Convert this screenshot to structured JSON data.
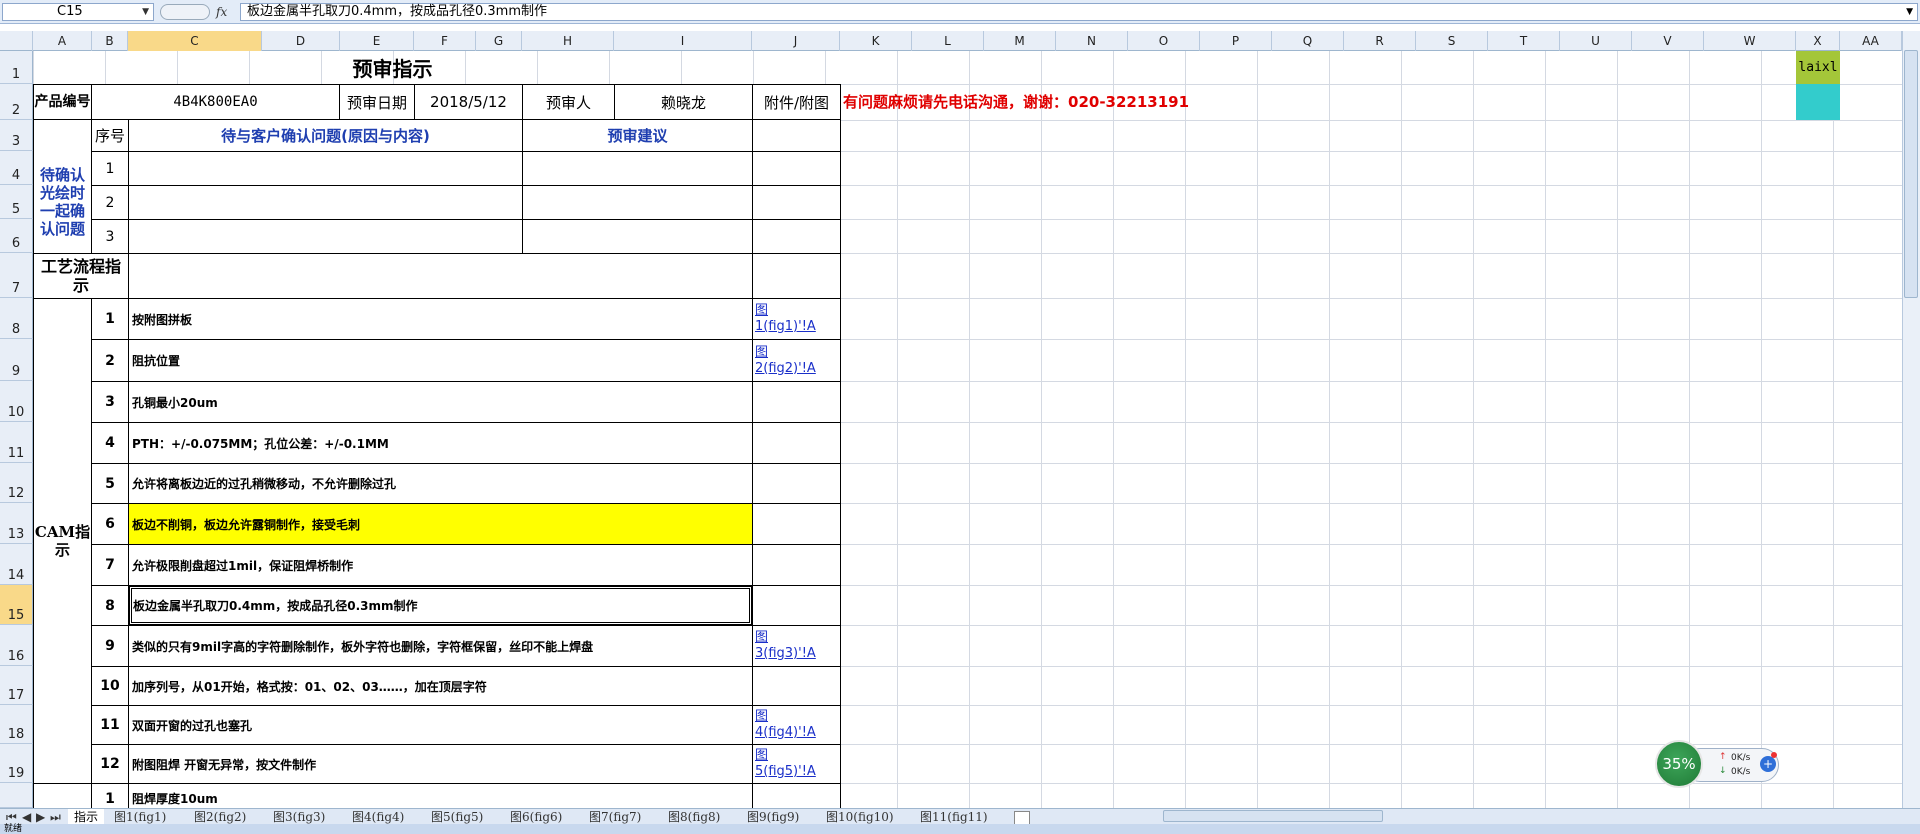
{
  "formula_bar": {
    "name_box": "C15",
    "fx_label": "fx",
    "formula": "板边金属半孔取刀0.4mm，按成品孔径0.3mm制作"
  },
  "columns": [
    "A",
    "B",
    "C",
    "D",
    "E",
    "F",
    "G",
    "H",
    "I",
    "J",
    "K",
    "L",
    "M",
    "N",
    "O",
    "P",
    "Q",
    "R",
    "S",
    "T",
    "U",
    "V",
    "W",
    "X",
    "AA"
  ],
  "rows": [
    "1",
    "2",
    "3",
    "4",
    "5",
    "6",
    "7",
    "8",
    "9",
    "10",
    "11",
    "12",
    "13",
    "14",
    "15",
    "16",
    "17",
    "18",
    "19"
  ],
  "sheet": {
    "title": "预审指示",
    "product_no_label": "产品编号",
    "product_no": "4B4K800EA0",
    "review_date_label": "预审日期",
    "review_date": "2018/5/12",
    "reviewer_label": "预审人",
    "reviewer": "赖晓龙",
    "attachment_label": "附件/附图",
    "contact_note": "有问题麻烦请先电话沟通，谢谢：020-32213191",
    "x1_value": "laixl",
    "seq_label": "序号",
    "question_header": "待与客户确认问题(原因与内容)",
    "suggestion_header": "预审建议",
    "pending_label": "待确认光绘时一起确认问题",
    "pending_seq": [
      "1",
      "2",
      "3"
    ],
    "process_label": "工艺流程指示",
    "cam_label": "CAM指示",
    "cam_items": [
      {
        "no": "1",
        "text": "按附图拼板",
        "link1": "图",
        "link2": "1(fig1)'!A"
      },
      {
        "no": "2",
        "text": "阻抗位置",
        "link1": "图",
        "link2": "2(fig2)'!A"
      },
      {
        "no": "3",
        "text": "孔铜最小20um",
        "link1": "",
        "link2": ""
      },
      {
        "no": "4",
        "text": "PTH：+/-0.075MM；孔位公差：+/-0.1MM",
        "link1": "",
        "link2": ""
      },
      {
        "no": "5",
        "text": "允许将离板边近的过孔稍微移动，不允许删除过孔",
        "link1": "",
        "link2": ""
      },
      {
        "no": "6",
        "text": "板边不削铜，板边允许露铜制作，接受毛刺",
        "link1": "",
        "link2": ""
      },
      {
        "no": "7",
        "text": "允许极限削盘超过1mil，保证阻焊桥制作",
        "link1": "",
        "link2": ""
      },
      {
        "no": "8",
        "text": "板边金属半孔取刀0.4mm，按成品孔径0.3mm制作",
        "link1": "",
        "link2": ""
      },
      {
        "no": "9",
        "text": "类似的只有9mil字高的字符删除制作，板外字符也删除，字符框保留，丝印不能上焊盘",
        "link1": "图",
        "link2": "3(fig3)'!A"
      },
      {
        "no": "10",
        "text": "加序列号，从01开始，格式按：01、02、03……，加在顶层字符",
        "link1": "",
        "link2": ""
      },
      {
        "no": "11",
        "text": "双面开窗的过孔也塞孔",
        "link1": "图",
        "link2": "4(fig4)'!A"
      },
      {
        "no": "12",
        "text": "附图阻焊 开窗无异常，按文件制作",
        "link1": "图",
        "link2": "5(fig5)'!A"
      }
    ],
    "next_no": "1",
    "next_text": "阻焊厚度10um"
  },
  "tabs": [
    "指示",
    "图1(fig1)",
    "图2(fig2)",
    "图3(fig3)",
    "图4(fig4)",
    "图5(fig5)",
    "图6(fig6)",
    "图7(fig7)",
    "图8(fig8)",
    "图9(fig9)",
    "图10(fig10)",
    "图11(fig11)"
  ],
  "nav_arrows": [
    "⏮",
    "◀",
    "▶",
    "⏭"
  ],
  "status_text": "就绪",
  "widget": {
    "percent": "35%",
    "up": "0K/s",
    "down": "0K/s",
    "plus": "+"
  },
  "colors": {
    "highlight_yellow": "#ffff00",
    "x1_green": "#a4c639",
    "x2_cyan": "#33cccc",
    "red_text": "#e00000",
    "blue_text": "#1f3fb0"
  }
}
